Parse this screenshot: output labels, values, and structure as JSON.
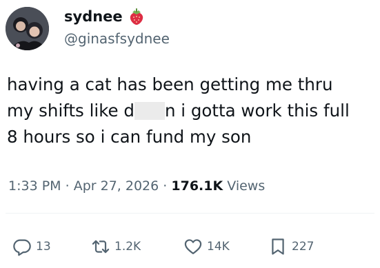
{
  "author": {
    "display_name": "sydnee",
    "handle": "@ginasfsydnee",
    "avatar": "profile-photo",
    "emoji": "strawberry"
  },
  "tweet": {
    "lines": [
      [
        "having a cat has been getting me thru"
      ],
      [
        "my shifts like d",
        "n i gotta work this full"
      ],
      [
        "8 hours so i can fund my son"
      ]
    ]
  },
  "meta": {
    "time": "1:33 PM",
    "separator": "·",
    "date": "Apr 27, 2026",
    "views_count": "176.1K",
    "views_label": "Views"
  },
  "actions": {
    "replies": "13",
    "reposts": "1.2K",
    "likes": "14K",
    "bookmarks": "227"
  },
  "colors": {
    "text": "#0f1419",
    "secondary": "#536471",
    "divider": "#eff3f4"
  }
}
